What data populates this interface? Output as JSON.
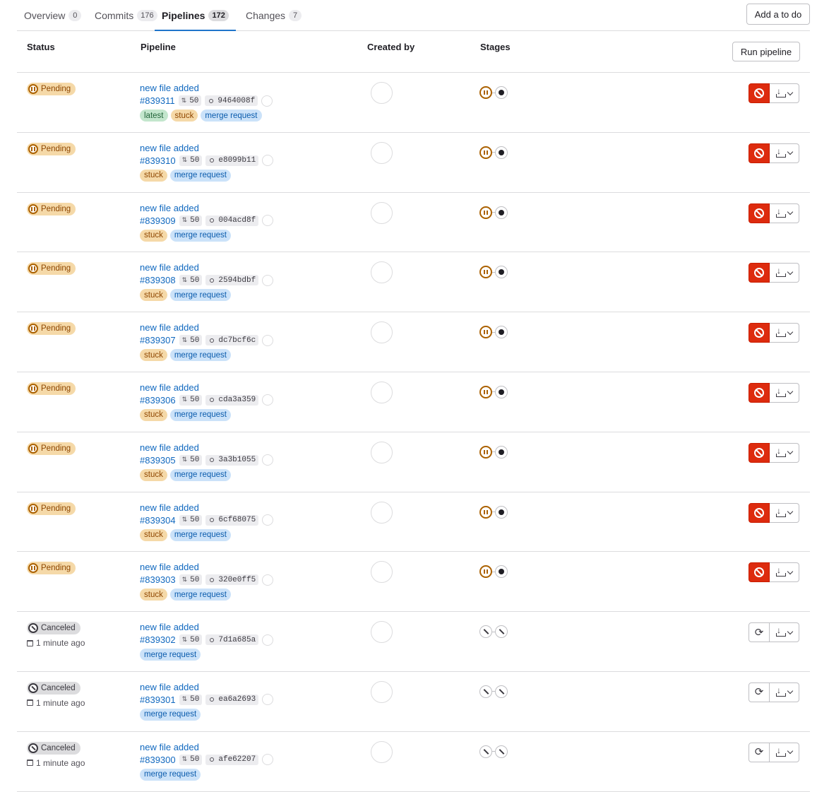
{
  "tabs": [
    {
      "label": "Overview",
      "count": "0"
    },
    {
      "label": "Commits",
      "count": "176"
    },
    {
      "label": "Pipelines",
      "count": "172",
      "active": true
    },
    {
      "label": "Changes",
      "count": "7"
    }
  ],
  "add_todo_label": "Add a to do",
  "run_pipeline_label": "Run pipeline",
  "columns": {
    "status": "Status",
    "pipeline": "Pipeline",
    "created_by": "Created by",
    "stages": "Stages"
  },
  "colors": {
    "link": "#1068bf",
    "pending": "#ab6100",
    "danger": "#dd2b0e"
  },
  "rows": [
    {
      "status": "Pending",
      "time": "",
      "title": "new file added",
      "id": "#839311",
      "mr": "50",
      "sha": "9464008f",
      "tags": [
        "latest",
        "stuck",
        "merge request"
      ]
    },
    {
      "status": "Pending",
      "time": "",
      "title": "new file added",
      "id": "#839310",
      "mr": "50",
      "sha": "e8099b11",
      "tags": [
        "stuck",
        "merge request"
      ]
    },
    {
      "status": "Pending",
      "time": "",
      "title": "new file added",
      "id": "#839309",
      "mr": "50",
      "sha": "004acd8f",
      "tags": [
        "stuck",
        "merge request"
      ]
    },
    {
      "status": "Pending",
      "time": "",
      "title": "new file added",
      "id": "#839308",
      "mr": "50",
      "sha": "2594bdbf",
      "tags": [
        "stuck",
        "merge request"
      ]
    },
    {
      "status": "Pending",
      "time": "",
      "title": "new file added",
      "id": "#839307",
      "mr": "50",
      "sha": "dc7bcf6c",
      "tags": [
        "stuck",
        "merge request"
      ]
    },
    {
      "status": "Pending",
      "time": "",
      "title": "new file added",
      "id": "#839306",
      "mr": "50",
      "sha": "cda3a359",
      "tags": [
        "stuck",
        "merge request"
      ]
    },
    {
      "status": "Pending",
      "time": "",
      "title": "new file added",
      "id": "#839305",
      "mr": "50",
      "sha": "3a3b1055",
      "tags": [
        "stuck",
        "merge request"
      ]
    },
    {
      "status": "Pending",
      "time": "",
      "title": "new file added",
      "id": "#839304",
      "mr": "50",
      "sha": "6cf68075",
      "tags": [
        "stuck",
        "merge request"
      ]
    },
    {
      "status": "Pending",
      "time": "",
      "title": "new file added",
      "id": "#839303",
      "mr": "50",
      "sha": "320e0ff5",
      "tags": [
        "stuck",
        "merge request"
      ]
    },
    {
      "status": "Canceled",
      "time": "1 minute ago",
      "title": "new file added",
      "id": "#839302",
      "mr": "50",
      "sha": "7d1a685a",
      "tags": [
        "merge request"
      ]
    },
    {
      "status": "Canceled",
      "time": "1 minute ago",
      "title": "new file added",
      "id": "#839301",
      "mr": "50",
      "sha": "ea6a2693",
      "tags": [
        "merge request"
      ]
    },
    {
      "status": "Canceled",
      "time": "1 minute ago",
      "title": "new file added",
      "id": "#839300",
      "mr": "50",
      "sha": "afe62207",
      "tags": [
        "merge request"
      ]
    }
  ]
}
